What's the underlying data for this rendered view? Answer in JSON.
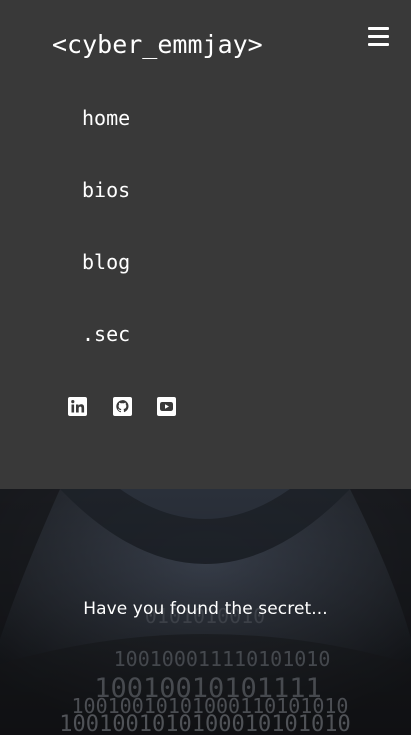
{
  "header": {
    "brand": "<cyber_emmjay>",
    "menu_icon": "hamburger-menu-icon"
  },
  "nav": {
    "items": [
      {
        "label": "home"
      },
      {
        "label": "bios"
      },
      {
        "label": "blog"
      },
      {
        "label": ".sec"
      }
    ]
  },
  "social": {
    "icons": [
      "linkedin-icon",
      "github-icon",
      "youtube-icon"
    ]
  },
  "hero": {
    "text": "Have you found the secret...",
    "background_icon": "hooded-hacker-binary-image",
    "binary_lines": [
      "0101010010",
      "100100011110101010",
      "10010010101111",
      "10010010101000110101010",
      "1001001010100010101010"
    ]
  },
  "colors": {
    "panel": "#393939",
    "text": "#ffffff",
    "hero_bg": "#1c1f24"
  }
}
